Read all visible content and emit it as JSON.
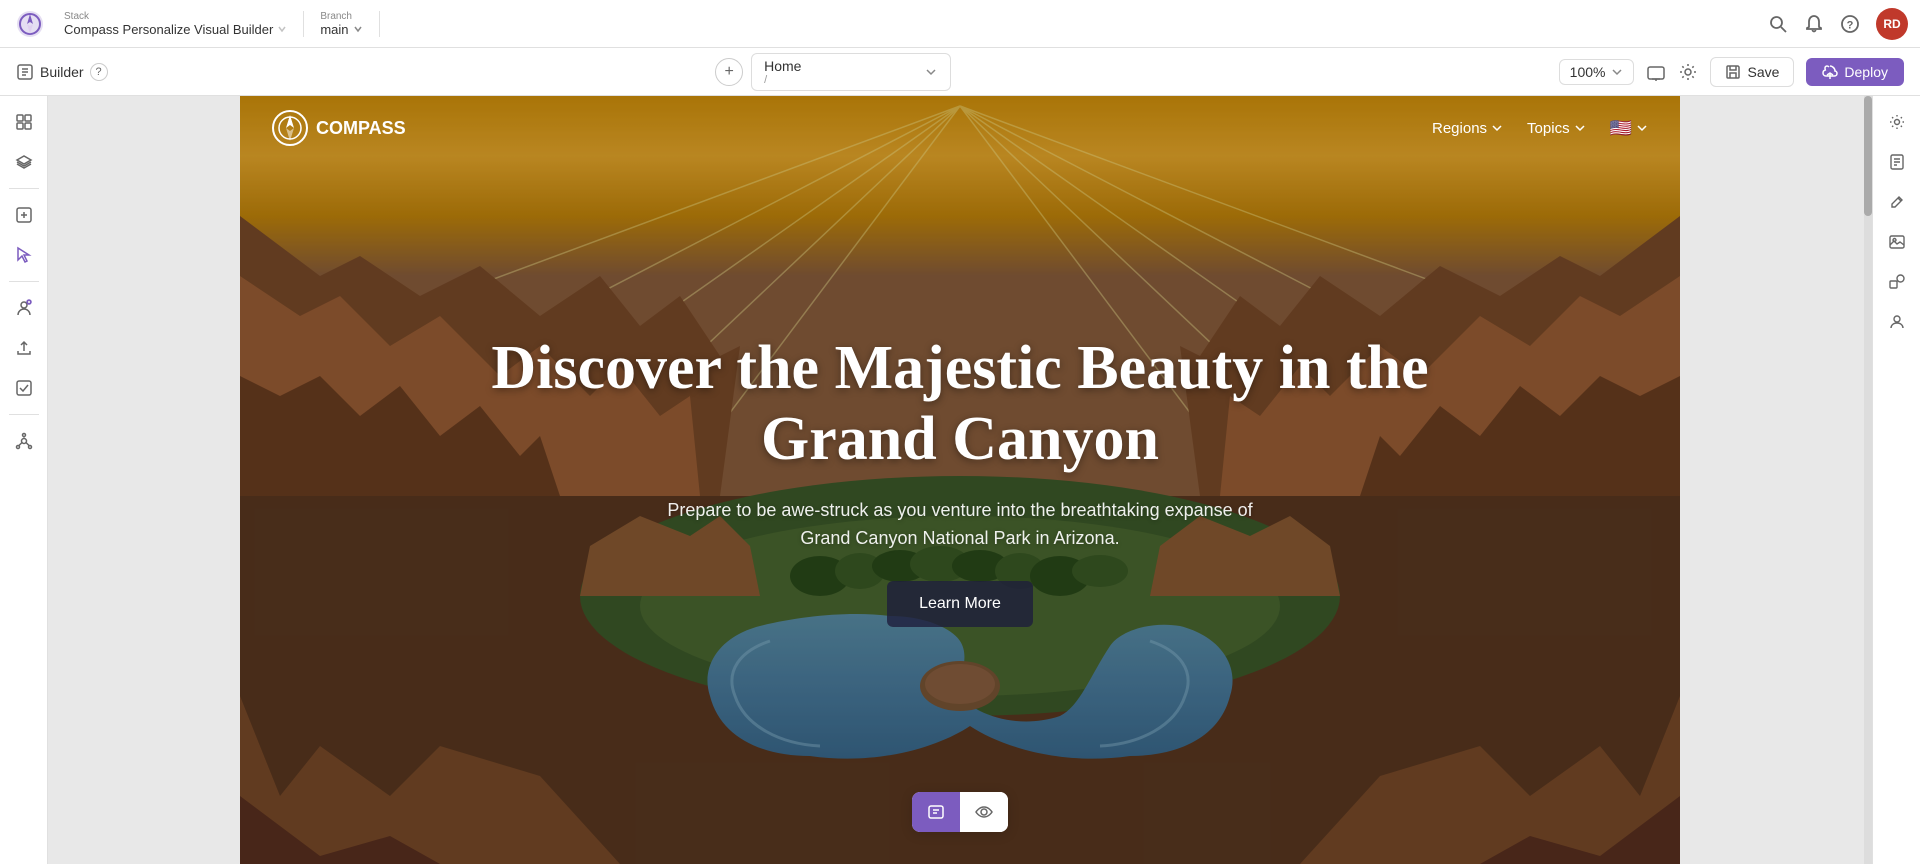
{
  "app": {
    "stack_label": "Stack",
    "stack_name": "Compass Personalize Visual Builder",
    "branch_label": "Branch",
    "branch_name": "main"
  },
  "topbar": {
    "search_icon": "search",
    "bell_icon": "bell",
    "help_icon": "help-circle",
    "user_initials": "RD"
  },
  "builder_bar": {
    "builder_label": "Builder",
    "help_label": "?",
    "add_page_label": "+",
    "page_name": "Home",
    "page_path": "/",
    "zoom_level": "100%",
    "save_label": "Save",
    "deploy_label": "Deploy"
  },
  "left_sidebar": {
    "icons": [
      "grid",
      "layers",
      "plus-square",
      "move",
      "sliders",
      "upload",
      "clipboard-check",
      "network"
    ]
  },
  "right_sidebar": {
    "icons": [
      "settings",
      "file-text",
      "edit",
      "image",
      "shapes",
      "user"
    ]
  },
  "site": {
    "logo_text": "COMPASS",
    "nav_items": [
      {
        "label": "Regions",
        "has_dropdown": true
      },
      {
        "label": "Topics",
        "has_dropdown": true
      },
      {
        "label": "flag",
        "is_flag": true
      }
    ],
    "hero": {
      "title": "Discover the Majestic Beauty in the Grand Canyon",
      "subtitle": "Prepare to be awe-struck as you venture into the breathtaking expanse of Grand Canyon National Park in Arizona.",
      "cta_label": "Learn More"
    }
  },
  "bottom_toolbar": {
    "btn1_icon": "edit-view",
    "btn2_icon": "preview"
  }
}
